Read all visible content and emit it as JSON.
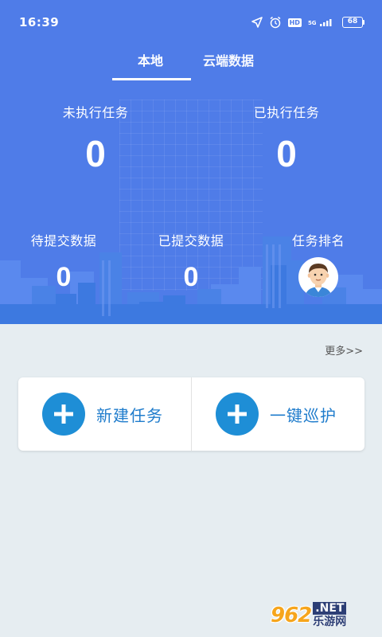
{
  "status_bar": {
    "time": "16:39",
    "icons": [
      "location-icon",
      "alarm-icon",
      "hd-icon",
      "5g-signal-icon",
      "battery-icon"
    ],
    "hd": "HD",
    "network": "5G",
    "battery": "68"
  },
  "tabs": [
    {
      "label": "本地",
      "active": true
    },
    {
      "label": "云端数据",
      "active": false
    }
  ],
  "stats": {
    "unexecuted": {
      "label": "未执行任务",
      "value": "0"
    },
    "executed": {
      "label": "已执行任务",
      "value": "0"
    },
    "pending_submit": {
      "label": "待提交数据",
      "value": "0"
    },
    "submitted": {
      "label": "已提交数据",
      "value": "0"
    },
    "ranking": {
      "label": "任务排名",
      "icon": "user-avatar-icon"
    }
  },
  "more_link": "更多>>",
  "actions": [
    {
      "label": "新建任务",
      "icon": "plus-icon"
    },
    {
      "label": "一键巡护",
      "icon": "plus-icon"
    }
  ],
  "watermark": {
    "logo": "962",
    "suffix": ".NET",
    "name": "乐游网"
  },
  "colors": {
    "header": "#4f7ce8",
    "page_bg": "#e6edf1",
    "action_icon": "#1e8ed6",
    "action_text": "#1f7ccc"
  }
}
